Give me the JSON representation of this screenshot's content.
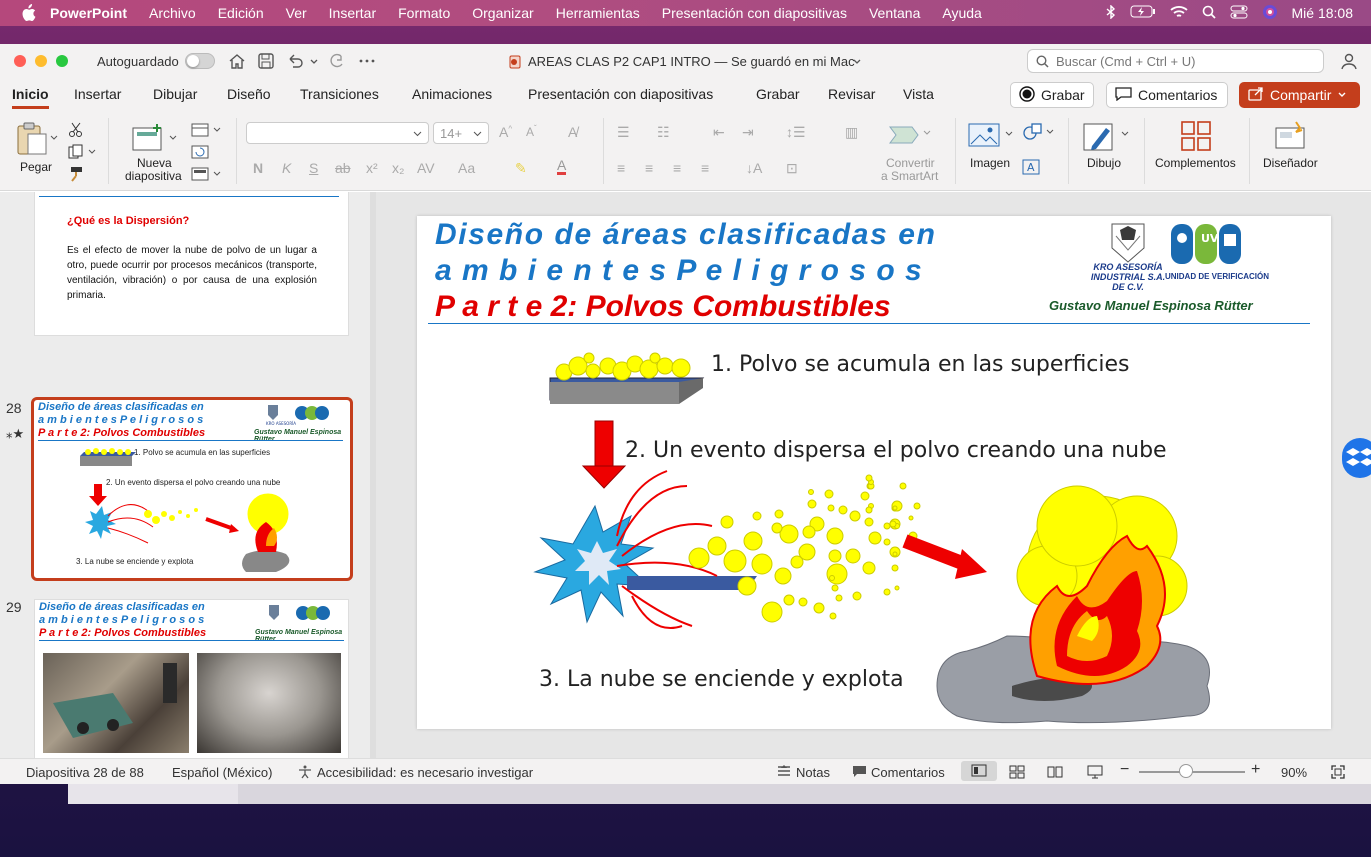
{
  "menubar": {
    "app": "PowerPoint",
    "items": [
      "Archivo",
      "Edición",
      "Ver",
      "Insertar",
      "Formato",
      "Organizar",
      "Herramientas",
      "Presentación con diapositivas",
      "Ventana",
      "Ayuda"
    ],
    "clock": "Mié  18:08"
  },
  "titlebar": {
    "autosave_label": "Autoguardado",
    "doc_title": "AREAS CLAS P2 CAP1 INTRO — Se guardó en mi Mac",
    "search_placeholder": "Buscar (Cmd + Ctrl + U)"
  },
  "tabs": {
    "items": [
      "Inicio",
      "Insertar",
      "Dibujar",
      "Diseño",
      "Transiciones",
      "Animaciones",
      "Presentación con diapositivas",
      "Grabar",
      "Revisar",
      "Vista"
    ],
    "active": "Inicio",
    "record_label": "Grabar",
    "comments_label": "Comentarios",
    "share_label": "Compartir"
  },
  "ribbon": {
    "paste_label": "Pegar",
    "new_slide_line1": "Nueva",
    "new_slide_line2": "diapositiva",
    "font_size": "14+",
    "smartart_line1": "Convertir",
    "smartart_line2": "a SmartArt",
    "image_label": "Imagen",
    "draw_label": "Dibujo",
    "addins_label": "Complementos",
    "designer_label": "Diseñador"
  },
  "thumbnails": {
    "prev": {
      "question": "¿Qué es la Dispersión?",
      "body": "Es el efecto de mover la nube de polvo de un lugar a otro, puede ocurrir por procesos mecánicos (transporte, ventilación, vibración) o por causa de una explosión primaria."
    },
    "slide28_number": "28",
    "slide29_number": "29",
    "title_line1": "Diseño  de  áreas  clasificadas  en",
    "title_line2": "a m b i e n t e s   P e l i g r o s o s",
    "title_line3": "P a r t e  2:  Polvos  Combustibles",
    "author": "Gustavo  Manuel  Espinosa  Rütter",
    "step1_small": "1. Polvo se acumula en las superficies",
    "step2_small": "2. Un evento dispersa el polvo creando una nube",
    "step3_small": "3. La nube se enciende y explota"
  },
  "slide": {
    "title_line1": "Diseño  de  áreas  clasificadas  en",
    "title_line2": "a m b i e n t e s   P e l i g r o s o s",
    "title_line3": "P a r t e  2:  Polvos  Combustibles",
    "author": "Gustavo  Manuel  Espinosa  Rütter",
    "logo1_text": "KRO ASESORÍA INDUSTRIAL S.A. DE C.V.",
    "logo2_text": "UNIDAD DE VERIFICACIÓN",
    "step1": "1. Polvo se acumula en las superficies",
    "step2": "2. Un evento dispersa el polvo creando una nube",
    "step3": "3. La nube se enciende y explota"
  },
  "status": {
    "slide_counter": "Diapositiva 28 de 88",
    "language": "Español (México)",
    "accessibility": "Accesibilidad: es necesario investigar",
    "notes": "Notas",
    "comments": "Comentarios",
    "zoom": "90%"
  },
  "colors": {
    "accent": "#c43e1c",
    "title_blue": "#1976c6",
    "title_red": "#e00000"
  }
}
